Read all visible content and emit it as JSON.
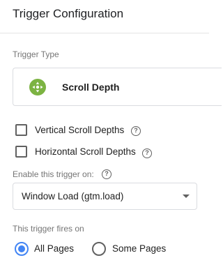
{
  "header": {
    "title": "Trigger Configuration"
  },
  "trigger_type": {
    "section_label": "Trigger Type",
    "selected_type": "Scroll Depth",
    "icon": "scroll-depth-icon",
    "icon_color": "#7cb342"
  },
  "options": {
    "vertical": {
      "label": "Vertical Scroll Depths",
      "checked": false
    },
    "horizontal": {
      "label": "Horizontal Scroll Depths",
      "checked": false
    }
  },
  "enable_on": {
    "label": "Enable this trigger on:",
    "selected": "Window Load (gtm.load)"
  },
  "fires_on": {
    "label": "This trigger fires on",
    "options": [
      {
        "label": "All Pages",
        "checked": true
      },
      {
        "label": "Some Pages",
        "checked": false
      }
    ],
    "accent_color": "#4285f4"
  }
}
